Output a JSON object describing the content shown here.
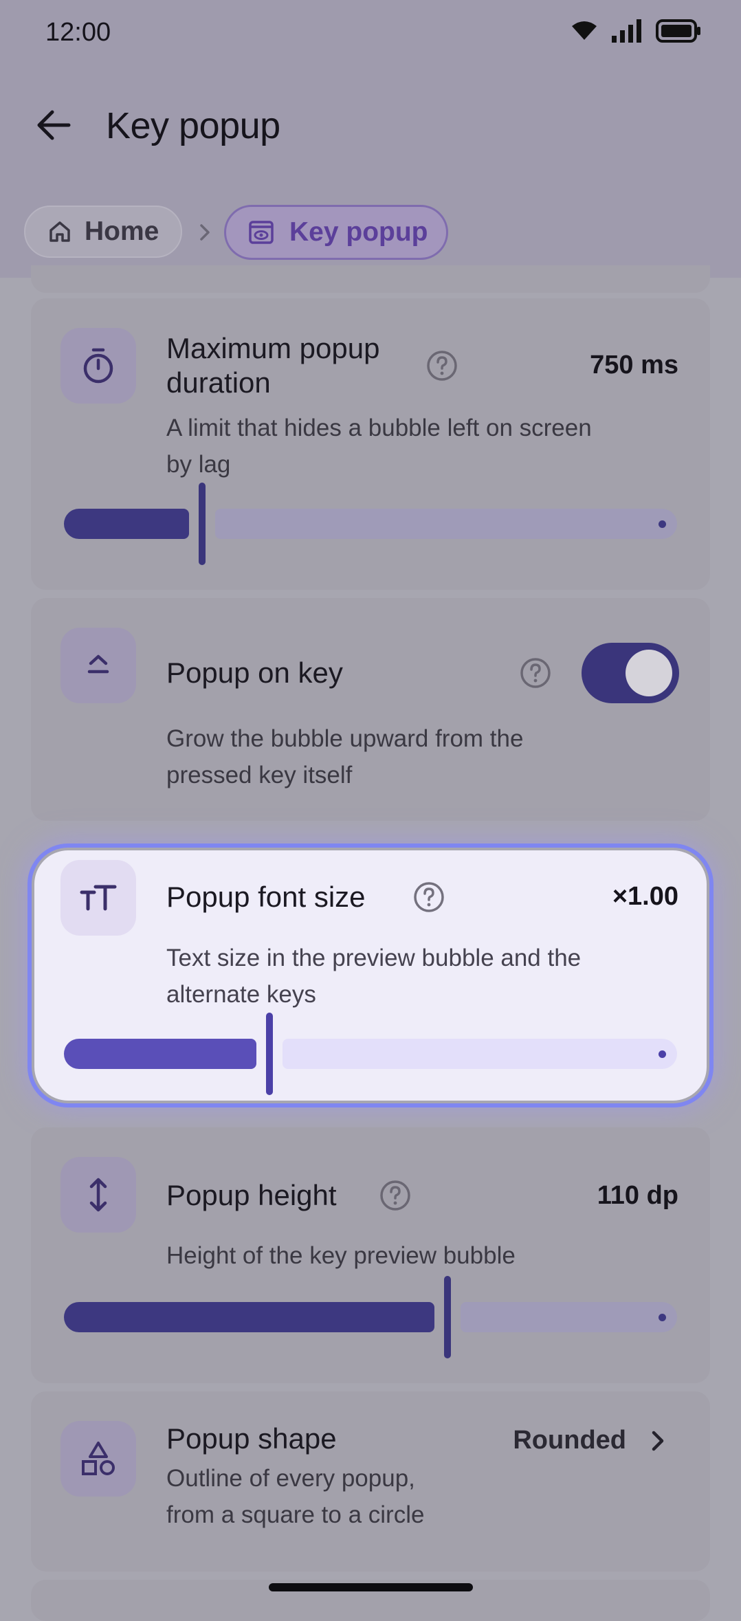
{
  "status_bar": {
    "time": "12:00"
  },
  "header": {
    "title": "Key popup"
  },
  "breadcrumb": {
    "home": "Home",
    "current": "Key popup"
  },
  "settings": {
    "max_duration": {
      "title_line1": "Maximum popup",
      "title_line2": "duration",
      "value": "750 ms",
      "desc_line1": "A limit that hides a bubble left on screen",
      "desc_line2": "by lag",
      "slider_fraction": 0.22
    },
    "popup_on_key": {
      "title": "Popup on key",
      "desc_line1": "Grow the bubble upward from the",
      "desc_line2": "pressed key itself",
      "enabled": true
    },
    "font_size": {
      "title": "Popup font size",
      "value": "×1.00",
      "desc_line1": "Text size in the preview bubble and the",
      "desc_line2": "alternate keys",
      "slider_fraction": 0.33
    },
    "popup_height": {
      "title": "Popup height",
      "value": "110 dp",
      "desc": "Height of the key preview bubble",
      "slider_fraction": 0.62
    },
    "popup_shape": {
      "title": "Popup shape",
      "value": "Rounded",
      "desc_line1": "Outline of every popup,",
      "desc_line2": "from a square to a circle"
    }
  },
  "icons": {
    "back": "arrow-left-icon",
    "home": "house-icon",
    "current": "eye-window-icon",
    "duration": "stopwatch-icon",
    "popup_on_key": "eject-up-icon",
    "font_size": "text-size-icon",
    "height": "vertical-arrows-icon",
    "shape": "shapes-icon",
    "help": "question-circle-icon"
  },
  "colors": {
    "accent": "#3a357b",
    "highlight_border": "#7f86f1",
    "breadcrumb_active": "#5b3f9a"
  }
}
